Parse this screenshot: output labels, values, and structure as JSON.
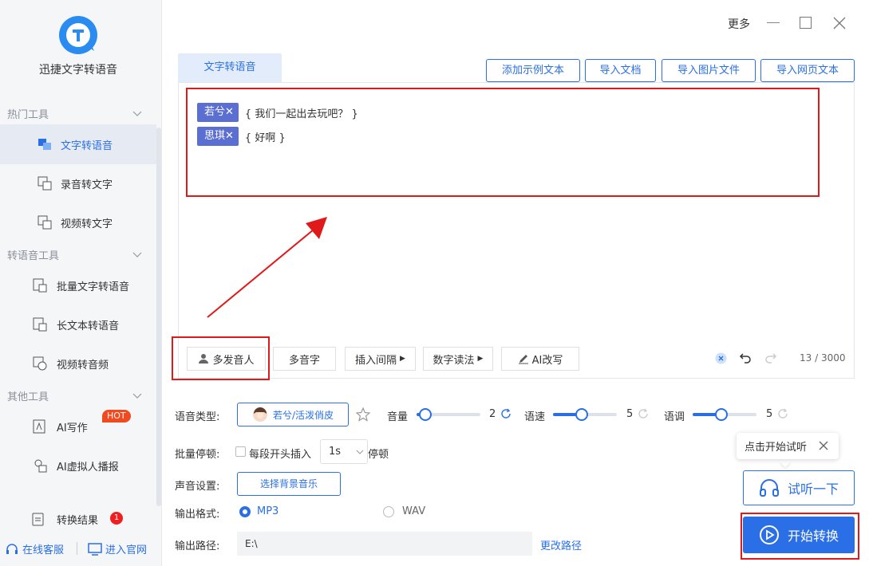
{
  "app": {
    "name": "迅捷文字转语音"
  },
  "window": {
    "more": "更多"
  },
  "sidebar": {
    "sections": [
      {
        "title": "热门工具",
        "items": [
          {
            "label": "文字转语音",
            "icon": "text-to-speech-icon",
            "active": true
          },
          {
            "label": "录音转文字",
            "icon": "recording-to-text-icon"
          },
          {
            "label": "视频转文字",
            "icon": "video-to-text-icon"
          }
        ]
      },
      {
        "title": "转语音工具",
        "items": [
          {
            "label": "批量文字转语音",
            "icon": "batch-text-icon"
          },
          {
            "label": "长文本转语音",
            "icon": "long-text-icon"
          },
          {
            "label": "视频转音频",
            "icon": "video-audio-icon"
          }
        ]
      },
      {
        "title": "其他工具",
        "items": [
          {
            "label": "AI写作",
            "icon": "ai-write-icon",
            "badge": "HOT"
          },
          {
            "label": "AI虚拟人播报",
            "icon": "ai-avatar-icon"
          }
        ]
      }
    ],
    "results": {
      "label": "转换结果",
      "count": "1"
    },
    "support": "在线客服",
    "website": "进入官网"
  },
  "tabs": {
    "active": "文字转语音"
  },
  "top_buttons": {
    "sample": "添加示例文本",
    "doc": "导入文档",
    "image": "导入图片文件",
    "web": "导入网页文本"
  },
  "editor": {
    "lines": [
      {
        "speaker": "若兮",
        "text": "{ 我们一起出去玩吧？ }"
      },
      {
        "speaker": "思琪",
        "text": "{ 好啊 }"
      }
    ],
    "counter": "13 / 3000"
  },
  "toolbar": {
    "multi_speaker": "多发音人",
    "polyphone": "多音字",
    "pause": "插入间隔",
    "number": "数字读法",
    "ai": "AI改写"
  },
  "settings": {
    "voice_type_label": "语音类型:",
    "voice": "若兮/活泼俏皮",
    "volume_label": "音量",
    "volume": "2",
    "speed_label": "语速",
    "speed": "5",
    "pitch_label": "语调",
    "pitch": "5",
    "batch_pause_label": "批量停顿:",
    "batch_pause_text": "每段开头插入",
    "pause_value": "1s",
    "pause_suffix": "停顿",
    "sound_label": "声音设置:",
    "bgm_button": "选择背景音乐",
    "format_label": "输出格式:",
    "format_mp3": "MP3",
    "format_wav": "WAV",
    "format_selected": "MP3",
    "path_label": "输出路径:",
    "path": "E:\\",
    "change_path": "更改路径"
  },
  "actions": {
    "tooltip": "点击开始试听",
    "listen": "试听一下",
    "start": "开始转换"
  },
  "colors": {
    "accent": "#2a6fe6",
    "speaker_tag": "#5b6fd3",
    "highlight": "#e01a1a",
    "hot": "#f04a1e"
  }
}
